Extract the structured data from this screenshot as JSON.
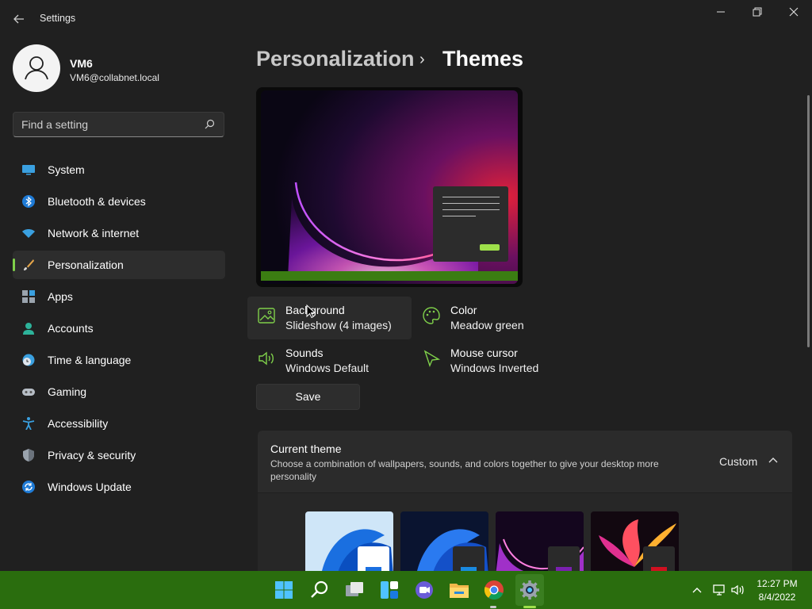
{
  "window": {
    "title": "Settings",
    "back_icon": "back-arrow-icon",
    "controls": [
      "minimize-icon",
      "restore-icon",
      "close-icon"
    ]
  },
  "profile": {
    "name": "VM6",
    "email": "VM6@collabnet.local"
  },
  "search": {
    "placeholder": "Find a setting",
    "value": ""
  },
  "sidebar": {
    "items": [
      {
        "label": "System",
        "icon": "monitor-icon",
        "active": false
      },
      {
        "label": "Bluetooth & devices",
        "icon": "bluetooth-icon",
        "active": false
      },
      {
        "label": "Network & internet",
        "icon": "wifi-icon",
        "active": false
      },
      {
        "label": "Personalization",
        "icon": "paintbrush-icon",
        "active": true
      },
      {
        "label": "Apps",
        "icon": "apps-icon",
        "active": false
      },
      {
        "label": "Accounts",
        "icon": "person-icon",
        "active": false
      },
      {
        "label": "Time & language",
        "icon": "globe-clock-icon",
        "active": false
      },
      {
        "label": "Gaming",
        "icon": "gamepad-icon",
        "active": false
      },
      {
        "label": "Accessibility",
        "icon": "accessibility-icon",
        "active": false
      },
      {
        "label": "Privacy & security",
        "icon": "shield-icon",
        "active": false
      },
      {
        "label": "Windows Update",
        "icon": "update-icon",
        "active": false
      }
    ]
  },
  "breadcrumb": {
    "parent": "Personalization",
    "separator": "›",
    "current": "Themes"
  },
  "options": {
    "background": {
      "title": "Background",
      "value": "Slideshow (4 images)",
      "icon": "image-icon"
    },
    "color": {
      "title": "Color",
      "value": "Meadow green",
      "icon": "palette-icon"
    },
    "sounds": {
      "title": "Sounds",
      "value": "Windows Default",
      "icon": "speaker-icon"
    },
    "cursor": {
      "title": "Mouse cursor",
      "value": "Windows Inverted",
      "icon": "cursor-icon"
    }
  },
  "save_label": "Save",
  "current_theme": {
    "title": "Current theme",
    "description": "Choose a combination of wallpapers, sounds, and colors together to give your desktop more personality",
    "value": "Custom"
  },
  "taskbar": {
    "apps": [
      "start-icon",
      "search-icon",
      "task-view-icon",
      "widgets-icon",
      "chat-icon",
      "file-explorer-icon",
      "chrome-icon",
      "settings-icon"
    ],
    "time": "12:27 PM",
    "date": "8/4/2022"
  },
  "colors": {
    "accent": "#7fd04a",
    "taskbar": "#2a6d0e",
    "background": "#202020"
  }
}
